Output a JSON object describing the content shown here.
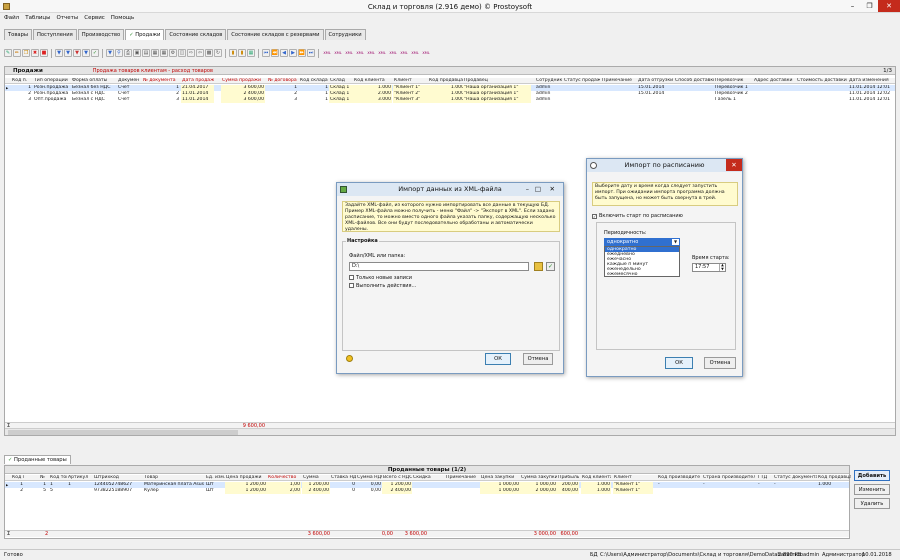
{
  "window": {
    "title": "Склад и торговля (2.916 демо) © Prostoysoft"
  },
  "menu": [
    "Файл",
    "Таблицы",
    "Отчеты",
    "Сервис",
    "Помощь"
  ],
  "tabs": [
    "Товары",
    "Поступления",
    "Производство",
    "Продажи",
    "Состояние складов",
    "Состояние складов с резервами",
    "Сотрудники"
  ],
  "sales": {
    "title": "Продажи",
    "subtitle": "Продажа товаров клиентам - расход товаров",
    "counter": "1/3",
    "headers": [
      "Код п.",
      "Тип операции",
      "Форма оплаты",
      "Документ",
      "№ документа",
      "Дата продажи",
      "Сумма продажи",
      "№ договора",
      "Код склада",
      "Склад",
      "Код клиента",
      "Клиент",
      "Код продавца",
      "Продавец",
      "Сотрудник",
      "Статус продажи",
      "Примечание",
      "Дата отгрузки",
      "Способ доставки",
      "Перевозчик",
      "Адрес доставки",
      "Стоимость доставки",
      "Дата изменения"
    ],
    "rows": [
      [
        "1",
        "Розн.продажа",
        "Безнал без НДС",
        "Счет",
        "1",
        "21.04.2017",
        "3 600,00",
        "1",
        "1",
        "Склад 1",
        "1.000",
        "\"Клиент 1\"",
        "1.000",
        "\"Наша организация 1\"",
        "admin",
        "",
        "",
        "15.01.2014",
        "",
        "Перевозчик 1",
        "",
        "",
        "11.01.2014 12:01"
      ],
      [
        "2",
        "Розн.продажа",
        "Безнал с НДС",
        "Счет",
        "2",
        "11.01.2014",
        "2 400,00",
        "2",
        "1",
        "Склад 1",
        "2.000",
        "\"Клиент 2\"",
        "1.000",
        "\"Наша организация 1\"",
        "admin",
        "",
        "",
        "15.01.2014",
        "",
        "Перевозчик 2",
        "",
        "",
        "11.01.2014 12:02"
      ],
      [
        "3",
        "Опт.продажа",
        "Безнал с НДС",
        "Счет",
        "3",
        "11.01.2014",
        "3 600,00",
        "3",
        "1",
        "Склад 1",
        "3.000",
        "\"Клиент 3\"",
        "1.000",
        "\"Наша организация 1\"",
        "admin",
        "",
        "",
        "",
        "",
        "Газель 1",
        "",
        "",
        "11.01.2014 12:01"
      ]
    ],
    "sum_sign": "Σ",
    "total": "9 600,00"
  },
  "sold_tab": "Проданные товары",
  "goods": {
    "title": "Проданные товары (1/2)",
    "headers": [
      "Код п.",
      "№",
      "Код товара",
      "Артикул",
      "Штрихкод",
      "Товар",
      "Ед. изм.",
      "Цена продажи",
      "Количество",
      "Сумма",
      "Ставка НДС",
      "Сумма НДС",
      "Всего с НДС",
      "Скидка",
      "Примечание",
      "Цена закупки",
      "Сумма закупки",
      "Прибыль",
      "Код клиента",
      "Клиент",
      "Код производителя",
      "Страна производителя",
      "ГТД",
      "Статус документа",
      "Код продавца"
    ],
    "rows": [
      [
        "1",
        "1",
        "1",
        "1",
        "1244052748627",
        "Материнская плата Asus",
        "Шт",
        "1 200,00",
        "1,00",
        "1 200,00",
        "0",
        "0,00",
        "1 200,00",
        "",
        "",
        "1 000,00",
        "1 000,00",
        "200,00",
        "1.000",
        "\"Клиент 1\"",
        "-",
        "-",
        "-",
        "-",
        "1.000"
      ],
      [
        "2",
        "5",
        "5",
        "",
        "9738225188907",
        "Кулер",
        "Шт",
        "1 200,00",
        "2,00",
        "2 400,00",
        "0",
        "0,00",
        "2 400,00",
        "",
        "",
        "1 000,00",
        "2 000,00",
        "400,00",
        "1.000",
        "\"Клиент 1\"",
        "",
        "",
        "",
        "",
        ""
      ]
    ],
    "sum_sign": "Σ",
    "totals": {
      "count": "2",
      "sum": "3 600,00",
      "vat": "0,00",
      "total": "3 600,00",
      "purchase": "3 000,00",
      "profit": "600,00"
    },
    "buttons": [
      "Добавить",
      "Изменить",
      "Удалить"
    ]
  },
  "xml_dialog": {
    "title": "Импорт данных из XML-файла",
    "info": "Задайте XML-файл, из которого нужно импортировать все данные в текущую БД. Пример XML-файла можно получить - меню \"Файл\" -> \"Экспорт в XML\". Если задано расписание, то можно вместо одного файла указать папку, содержащую несколько XML-файлов. Все они будут последовательно обработаны и автоматически удалены.",
    "group": "Настройка",
    "path_label": "Файл/XML или папка:",
    "path_value": "D:\\",
    "check_new": "Только новые записи",
    "check_actions": "Выполнить действия...",
    "ok": "ОК",
    "cancel": "Отмена"
  },
  "sched_dialog": {
    "title": "Импорт по расписанию",
    "info": "Выберите дату и время когда следует запустить импорт. При ожидании импорта программа должна быть запущена, но может быть свернута в трей.",
    "enable": "Включить старт по расписанию",
    "period_label": "Периодичность:",
    "period_value": "однократно",
    "options": [
      "однократно",
      "ежедневно",
      "ежечасно",
      "каждые п минут",
      "еженедельно",
      "ежемесячно"
    ],
    "time_label": "Время старта:",
    "time_value": "17:57",
    "ok": "ОК",
    "cancel": "Отмена"
  },
  "status": {
    "ready": "Готово",
    "db_label": "БД",
    "db_path": "C:\\Users\\Администратор\\Documents\\Склад и торговля\\DemoDatabase.mdb",
    "size": "2 896 Kb",
    "user": "admin",
    "role": "Администратор",
    "date": "10.01.2018"
  },
  "colors": {
    "accent_red": "#c00000",
    "selection": "#d8e8ff",
    "highlight_yellow": "#fffbd0",
    "info_bg": "#fffbcf"
  }
}
